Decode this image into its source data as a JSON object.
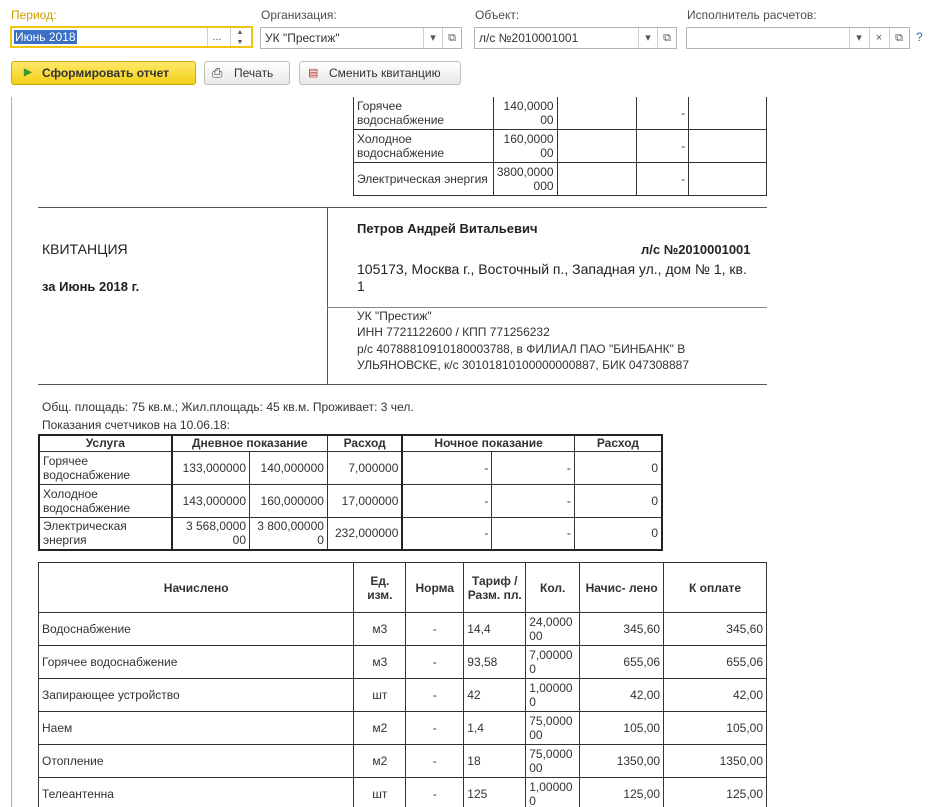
{
  "toolbar": {
    "period_label": "Период:",
    "period_value": "Июнь 2018",
    "period_dots": "...",
    "org_label": "Организация:",
    "org_value": "УК \"Престиж\"",
    "object_label": "Объект:",
    "object_value": "л/с №2010001001",
    "executor_label": "Исполнитель расчетов:",
    "executor_value": "",
    "clear_glyph": "×",
    "help_glyph": "?",
    "generate_label": "Сформировать отчет",
    "print_label": "Печать",
    "change_label": "Сменить квитанцию"
  },
  "top_table": {
    "rows": [
      {
        "name": "Горячее водоснабжение",
        "value": "140,0000 00",
        "dash": "-"
      },
      {
        "name": "Холодное водоснабжение",
        "value": "160,0000 00",
        "dash": "-"
      },
      {
        "name": "Электрическая энергия",
        "value": "3800,0000 000",
        "dash": "-"
      }
    ]
  },
  "receipt": {
    "title": "КВИТАНЦИЯ",
    "period": "за Июнь 2018 г.",
    "payer_name": "Петров Андрей Витальевич",
    "account": "л/с №2010001001",
    "address": "105173, Москва г., Восточный п., Западная ул., дом № 1, кв. 1",
    "org_name": "УК \"Престиж\"",
    "org_inn": "ИНН 7721122600 / КПП 771256232",
    "org_bank": "р/с 40788810910180003788, в ФИЛИАЛ ПАО \"БИНБАНК\" В УЛЬЯНОВСКЕ, к/с 30101810100000000887, БИК 047308887"
  },
  "area_line": "Общ. площадь: 75 кв.м.; Жил.площадь: 45 кв.м. Проживает: 3 чел.",
  "meters_line": "Показания счетчиков на 10.06.18:",
  "meters": {
    "headers": [
      "Услуга",
      "Дневное показание",
      "Расход",
      "Ночное показание",
      "Расход"
    ],
    "rows": [
      {
        "service": "Горячее водоснабжение",
        "day_prev": "133,000000",
        "day_cur": "140,000000",
        "day_use": "7,000000",
        "night_prev": "-",
        "night_cur": "-",
        "night_use": "0"
      },
      {
        "service": "Холодное водоснабжение",
        "day_prev": "143,000000",
        "day_cur": "160,000000",
        "day_use": "17,000000",
        "night_prev": "-",
        "night_cur": "-",
        "night_use": "0"
      },
      {
        "service": "Электрическая энергия",
        "day_prev": "3 568,0000 00",
        "day_cur": "3 800,00000 0",
        "day_use": "232,000000",
        "night_prev": "-",
        "night_cur": "-",
        "night_use": "0"
      }
    ]
  },
  "charges": {
    "headers": [
      "Начислено",
      "Ед. изм.",
      "Норма",
      "Тариф / Разм. пл.",
      "Кол.",
      "Начис- лено",
      "К оплате"
    ],
    "rows": [
      {
        "name": "Водоснабжение",
        "unit": "м3",
        "norm": "-",
        "tariff": "14,4",
        "qty": "24,0000 00",
        "charged": "345,60",
        "pay": "345,60"
      },
      {
        "name": "Горячее водоснабжение",
        "unit": "м3",
        "norm": "-",
        "tariff": "93,58",
        "qty": "7,00000 0",
        "charged": "655,06",
        "pay": "655,06"
      },
      {
        "name": "Запирающее устройство",
        "unit": "шт",
        "norm": "-",
        "tariff": "42",
        "qty": "1,00000 0",
        "charged": "42,00",
        "pay": "42,00"
      },
      {
        "name": "Наем",
        "unit": "м2",
        "norm": "-",
        "tariff": "1,4",
        "qty": "75,0000 00",
        "charged": "105,00",
        "pay": "105,00"
      },
      {
        "name": "Отопление",
        "unit": "м2",
        "norm": "-",
        "tariff": "18",
        "qty": "75,0000 00",
        "charged": "1350,00",
        "pay": "1350,00"
      },
      {
        "name": "Телеантенна",
        "unit": "шт",
        "norm": "-",
        "tariff": "125",
        "qty": "1,00000 0",
        "charged": "125,00",
        "pay": "125,00"
      }
    ]
  }
}
